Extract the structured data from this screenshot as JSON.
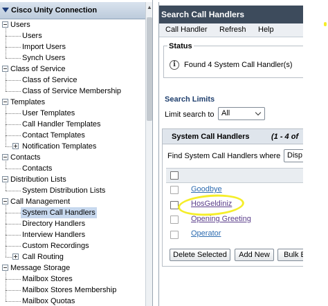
{
  "nav": {
    "title": "Cisco Unity Connection",
    "groups": [
      {
        "label": "Users",
        "items": [
          "Users",
          "Import Users",
          "Synch Users"
        ]
      },
      {
        "label": "Class of Service",
        "items": [
          "Class of Service",
          "Class of Service Membership"
        ]
      },
      {
        "label": "Templates",
        "items": [
          "User Templates",
          "Call Handler Templates",
          "Contact Templates",
          "Notification Templates"
        ]
      },
      {
        "label": "Contacts",
        "items": [
          "Contacts"
        ]
      },
      {
        "label": "Distribution Lists",
        "items": [
          "System Distribution Lists"
        ]
      },
      {
        "label": "Call Management",
        "items": [
          "System Call Handlers",
          "Directory Handlers",
          "Interview Handlers",
          "Custom Recordings",
          "Call Routing"
        ]
      },
      {
        "label": "Message Storage",
        "items": [
          "Mailbox Stores",
          "Mailbox Stores Membership",
          "Mailbox Quotas"
        ]
      }
    ],
    "selected": "System Call Handlers"
  },
  "page": {
    "title": "Search Call Handlers",
    "menu": [
      "Call Handler",
      "Refresh",
      "Help"
    ]
  },
  "status": {
    "legend": "Status",
    "message": "Found 4 System Call Handler(s)"
  },
  "search_limits": {
    "heading": "Search Limits",
    "label": "Limit search to",
    "value": "All"
  },
  "results": {
    "title": "System Call Handlers",
    "count": "(1 - 4 of",
    "find_label": "Find System Call Handlers where",
    "find_select": "Disp",
    "rows": [
      "Goodbye",
      "HosGeldiniz",
      "Opening Greeting",
      "Operator"
    ]
  },
  "buttons": {
    "delete": "Delete Selected",
    "add": "Add New",
    "bulk": "Bulk E"
  },
  "colors": {
    "header_bg": "#3d4b5c",
    "link": "#2c6bb0",
    "highlight": "#f5ee2a"
  }
}
